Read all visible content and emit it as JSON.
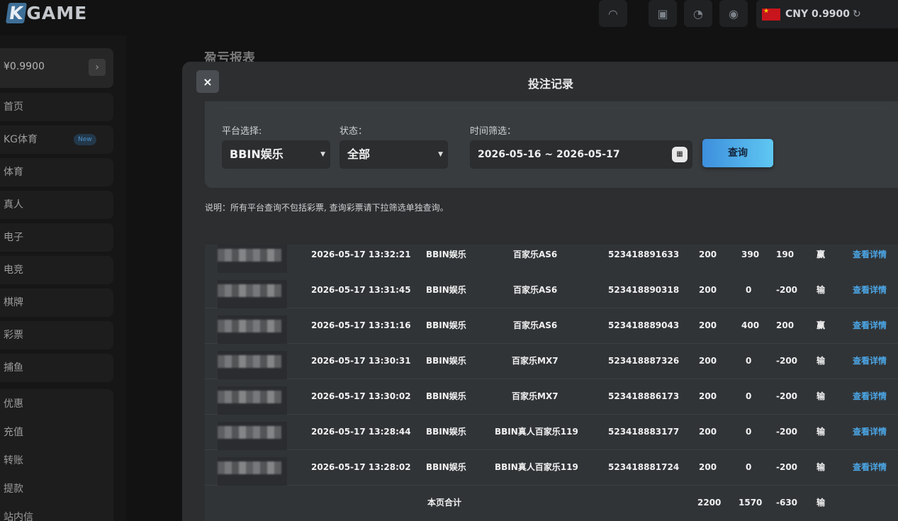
{
  "header": {
    "logo": "KGAME",
    "wallet": {
      "currency": "CNY",
      "amount": "0.9900",
      "display": "CNY 0.9900"
    }
  },
  "sidebar": {
    "balance": "¥0.9900",
    "items": [
      {
        "label": "首页"
      },
      {
        "label": "KG体育",
        "badge": "New"
      },
      {
        "label": "体育"
      },
      {
        "label": "真人"
      },
      {
        "label": "电子"
      },
      {
        "label": "电竞"
      },
      {
        "label": "棋牌"
      },
      {
        "label": "彩票"
      },
      {
        "label": "捕鱼"
      }
    ],
    "sub_items": [
      {
        "label": "优惠"
      },
      {
        "label": "充值"
      },
      {
        "label": "转账"
      },
      {
        "label": "提款"
      },
      {
        "label": "站内信"
      }
    ]
  },
  "background": {
    "page_title": "盈亏报表"
  },
  "modal": {
    "title": "投注记录",
    "close": "×",
    "filters": {
      "platform_label": "平台选择:",
      "platform_value": "BBIN娱乐",
      "status_label": "状态：",
      "status_value": "全部",
      "time_label": "时间筛选：",
      "time_value": "2026-05-16 ~ 2026-05-17",
      "query_button": "查询"
    },
    "note": "说明：所有平台查询不包括彩票, 查询彩票请下拉筛选单独查询。",
    "rows": [
      {
        "time": "2026-05-17 13:32:21",
        "platform": "BBIN娱乐",
        "game": "百家乐AS6",
        "order": "523418891633",
        "bet": "200",
        "payout": "390",
        "profit": "190",
        "result": "赢",
        "action": "查看详情"
      },
      {
        "time": "2026-05-17 13:31:45",
        "platform": "BBIN娱乐",
        "game": "百家乐AS6",
        "order": "523418890318",
        "bet": "200",
        "payout": "0",
        "profit": "-200",
        "result": "输",
        "action": "查看详情"
      },
      {
        "time": "2026-05-17 13:31:16",
        "platform": "BBIN娱乐",
        "game": "百家乐AS6",
        "order": "523418889043",
        "bet": "200",
        "payout": "400",
        "profit": "200",
        "result": "赢",
        "action": "查看详情"
      },
      {
        "time": "2026-05-17 13:30:31",
        "platform": "BBIN娱乐",
        "game": "百家乐MX7",
        "order": "523418887326",
        "bet": "200",
        "payout": "0",
        "profit": "-200",
        "result": "输",
        "action": "查看详情"
      },
      {
        "time": "2026-05-17 13:30:02",
        "platform": "BBIN娱乐",
        "game": "百家乐MX7",
        "order": "523418886173",
        "bet": "200",
        "payout": "0",
        "profit": "-200",
        "result": "输",
        "action": "查看详情"
      },
      {
        "time": "2026-05-17 13:28:44",
        "platform": "BBIN娱乐",
        "game": "BBIN真人百家乐119",
        "order": "523418883177",
        "bet": "200",
        "payout": "0",
        "profit": "-200",
        "result": "输",
        "action": "查看详情"
      },
      {
        "time": "2026-05-17 13:28:02",
        "platform": "BBIN娱乐",
        "game": "BBIN真人百家乐119",
        "order": "523418881724",
        "bet": "200",
        "payout": "0",
        "profit": "-200",
        "result": "输",
        "action": "查看详情"
      }
    ],
    "total": {
      "label": "本页合计",
      "bet": "2200",
      "payout": "1570",
      "profit": "-630",
      "result": "输"
    }
  },
  "colors": {
    "accent": "#4ba6e6",
    "background": "#121212",
    "modal": "#2c2e30"
  }
}
